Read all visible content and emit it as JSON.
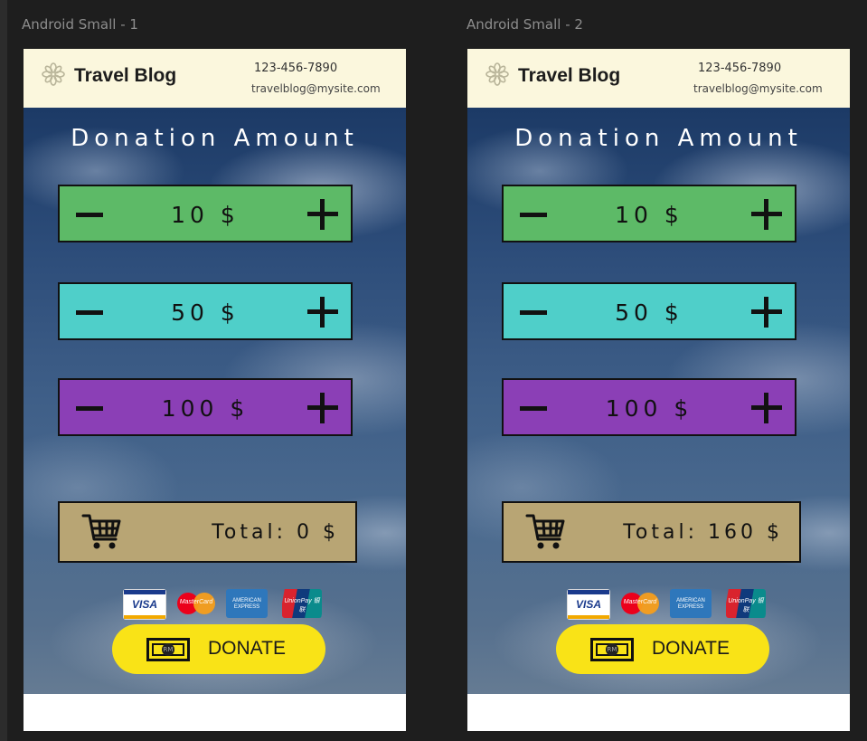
{
  "frames": [
    {
      "label": "Android Small - 1",
      "header": {
        "brand": "Travel Blog",
        "phone": "123-456-7890",
        "email": "travelblog@mysite.com"
      },
      "title": "Donation Amount",
      "steppers": [
        {
          "amount": "10 $",
          "color": "#5dba67"
        },
        {
          "amount": "50 $",
          "color": "#4fcfc9"
        },
        {
          "amount": "100 $",
          "color": "#8b3fb6"
        }
      ],
      "total": "Total: 0 $",
      "payment_cards": [
        "VISA",
        "MasterCard",
        "AMERICAN EXPRESS",
        "UnionPay 银联"
      ],
      "donate_icon_text": "RM",
      "donate_label": "DONATE"
    },
    {
      "label": "Android Small - 2",
      "header": {
        "brand": "Travel Blog",
        "phone": "123-456-7890",
        "email": "travelblog@mysite.com"
      },
      "title": "Donation Amount",
      "steppers": [
        {
          "amount": "10 $",
          "color": "#5dba67"
        },
        {
          "amount": "50 $",
          "color": "#4fcfc9"
        },
        {
          "amount": "100 $",
          "color": "#8b3fb6"
        }
      ],
      "total": "Total: 160 $",
      "payment_cards": [
        "VISA",
        "MasterCard",
        "AMERICAN EXPRESS",
        "UnionPay 银联"
      ],
      "donate_icon_text": "RM",
      "donate_label": "DONATE"
    }
  ],
  "icons": {
    "logo": "flower-logo-icon",
    "cart": "shopping-cart-icon",
    "cash": "cash-note-icon",
    "minus": "minus-icon",
    "plus": "plus-icon"
  },
  "colors": {
    "header_bg": "#fbf7dd",
    "total_bg": "#b8a574",
    "donate_bg": "#f9e317",
    "canvas_bg": "#1e1e1e"
  }
}
